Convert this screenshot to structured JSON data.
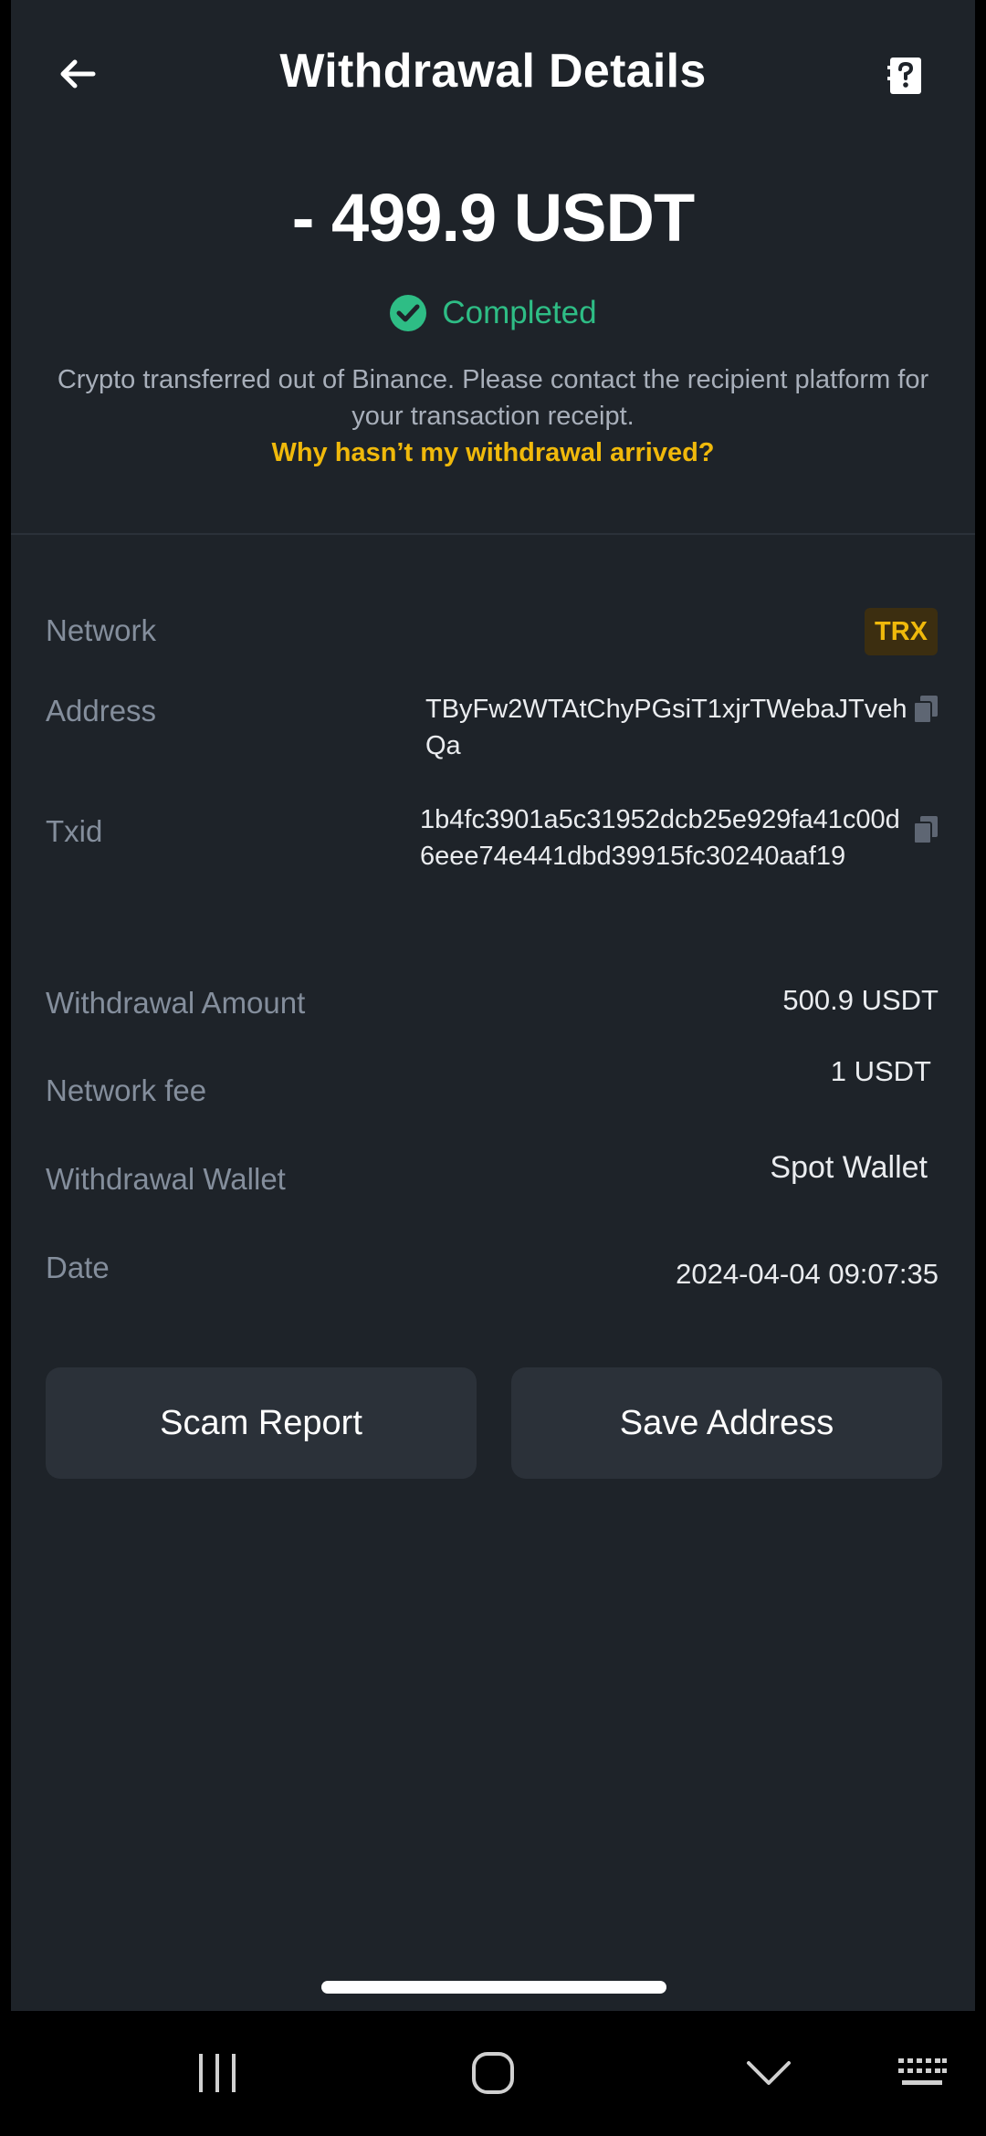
{
  "header": {
    "title": "Withdrawal Details"
  },
  "summary": {
    "amount": "- 499.9 USDT",
    "status": "Completed",
    "note": "Crypto transferred out of Binance. Please contact the recipient platform for your transaction receipt.",
    "help_link": "Why hasn’t my withdrawal arrived?"
  },
  "details": {
    "network_label": "Network",
    "network_value": "TRX",
    "address_label": "Address",
    "address_value": "TByFw2WTAtChyPGsiT1xjrTWebaJTvehQa",
    "txid_label": "Txid",
    "txid_value": "1b4fc3901a5c31952dcb25e929fa41c00d6eee74e441dbd39915fc30240aaf19",
    "amount_label": "Withdrawal Amount",
    "amount_value": "500.9 USDT",
    "fee_label": "Network fee",
    "fee_value": "1 USDT",
    "wallet_label": "Withdrawal Wallet",
    "wallet_value": "Spot Wallet",
    "date_label": "Date",
    "date_value": "2024-04-04 09:07:35"
  },
  "actions": {
    "scam_report": "Scam Report",
    "save_address": "Save Address"
  },
  "colors": {
    "background": "#1E2329",
    "success": "#2EBD85",
    "accent": "#F0B90B",
    "muted": "#848E9C"
  },
  "icons": [
    "back-arrow-icon",
    "help-document-icon",
    "check-circle-icon",
    "copy-icon",
    "recent-apps-icon",
    "home-icon",
    "back-chevron-icon",
    "keyboard-icon"
  ]
}
